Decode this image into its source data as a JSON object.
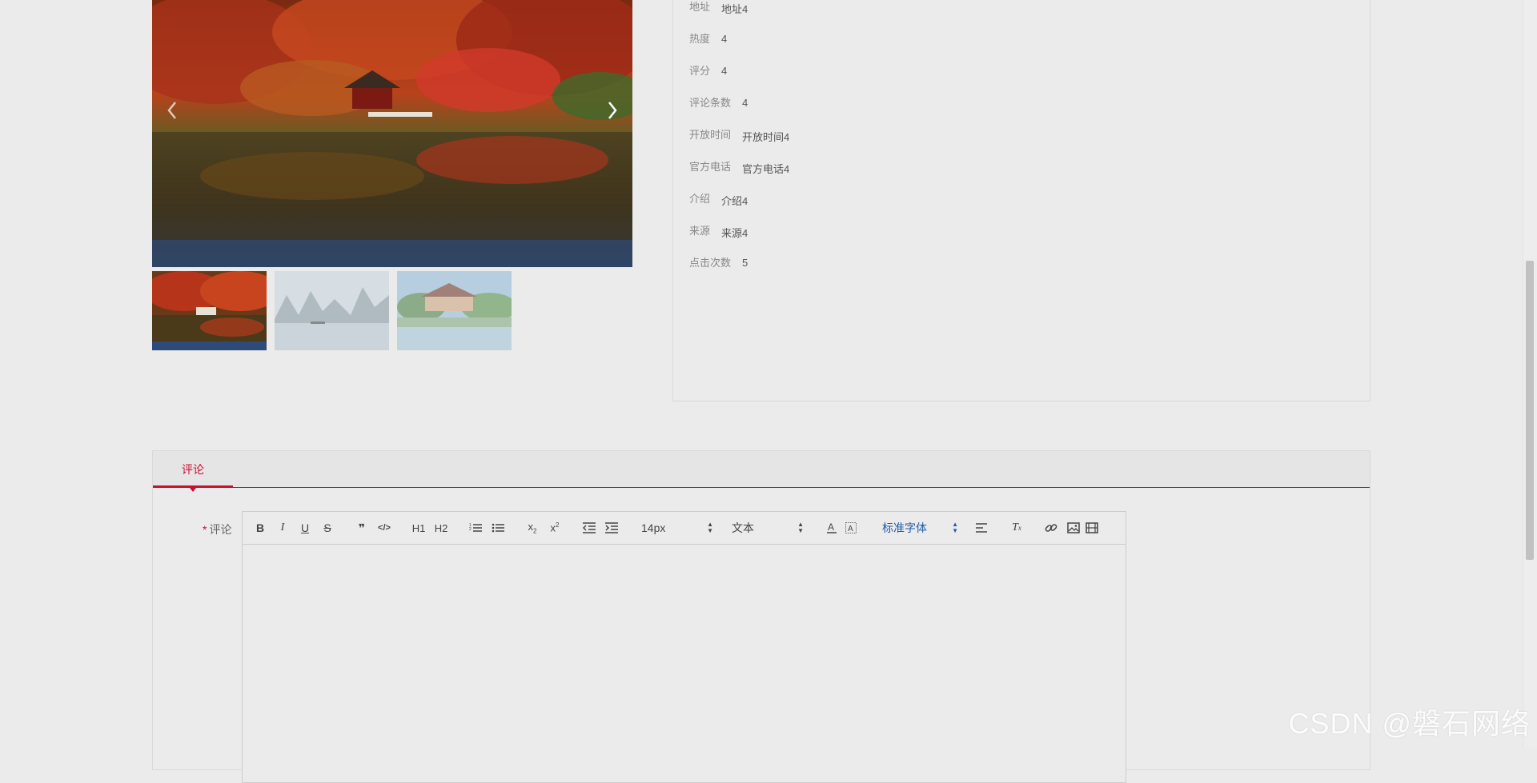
{
  "gallery": {
    "prev_arrow": "‹",
    "next_arrow": "›"
  },
  "info": {
    "rows": [
      {
        "label": "地址",
        "value": "地址4"
      },
      {
        "label": "热度",
        "value": "4"
      },
      {
        "label": "评分",
        "value": "4"
      },
      {
        "label": "评论条数",
        "value": "4"
      },
      {
        "label": "开放时间",
        "value": "开放时间4"
      },
      {
        "label": "官方电话",
        "value": "官方电话4"
      },
      {
        "label": "介绍",
        "value": "介绍4"
      },
      {
        "label": "来源",
        "value": "来源4"
      },
      {
        "label": "点击次数",
        "value": "5"
      }
    ]
  },
  "comment": {
    "tab_label": "评论",
    "field_label": "评论",
    "required_mark": "*",
    "toolbar": {
      "bold": "B",
      "italic": "I",
      "underline": "U",
      "strike": "S",
      "quote": "❞",
      "code": "</>",
      "h1": "H1",
      "h2": "H2",
      "font_size": "14px",
      "header": "文本",
      "font_family": "标准字体",
      "clean": "Tx"
    }
  },
  "watermark": "CSDN @磐石网络",
  "colors": {
    "accent": "#c8102e",
    "link_blue": "#1e5ba8",
    "background": "#ebebeb"
  }
}
